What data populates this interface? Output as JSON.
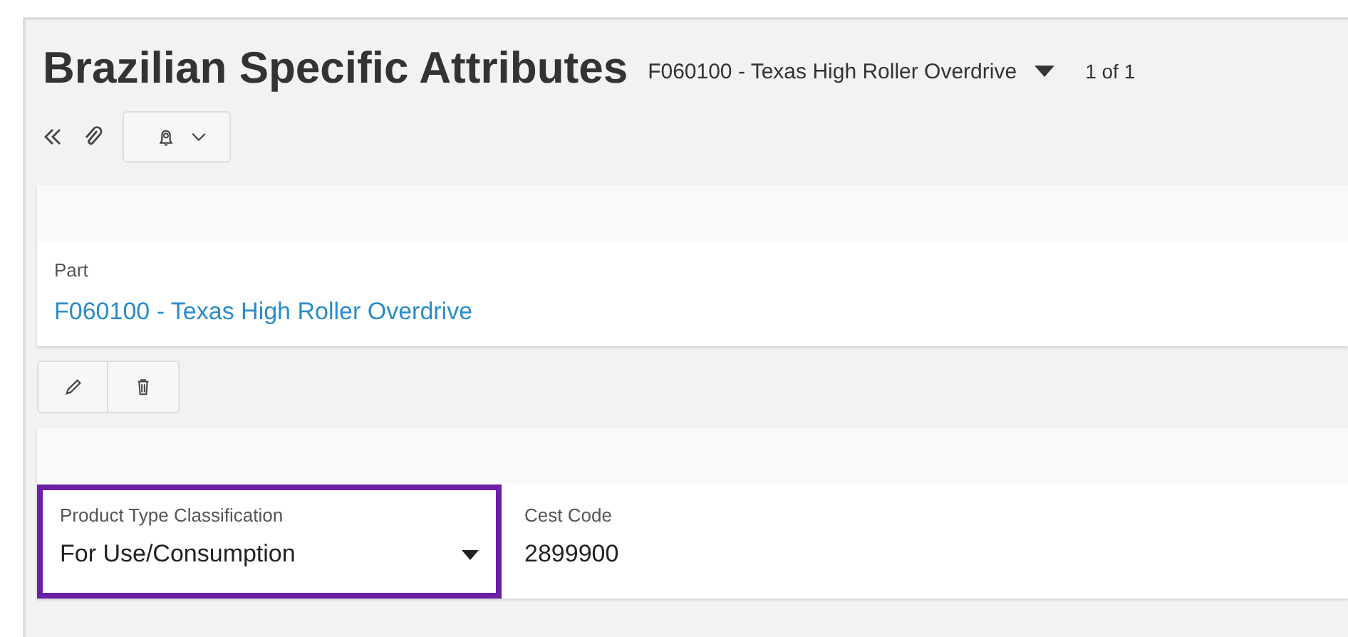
{
  "header": {
    "title": "Brazilian Specific Attributes",
    "record": "F060100 - Texas High Roller Overdrive",
    "pager": "1 of 1"
  },
  "part_card": {
    "label": "Part",
    "value": "F060100 - Texas High Roller Overdrive"
  },
  "detail_card": {
    "fields": [
      {
        "kind": "dropdown",
        "label": "Product Type Classification",
        "value": "For Use/Consumption",
        "highlighted": true
      },
      {
        "kind": "text",
        "label": "Cest Code",
        "value": "2899900",
        "highlighted": false
      }
    ]
  }
}
